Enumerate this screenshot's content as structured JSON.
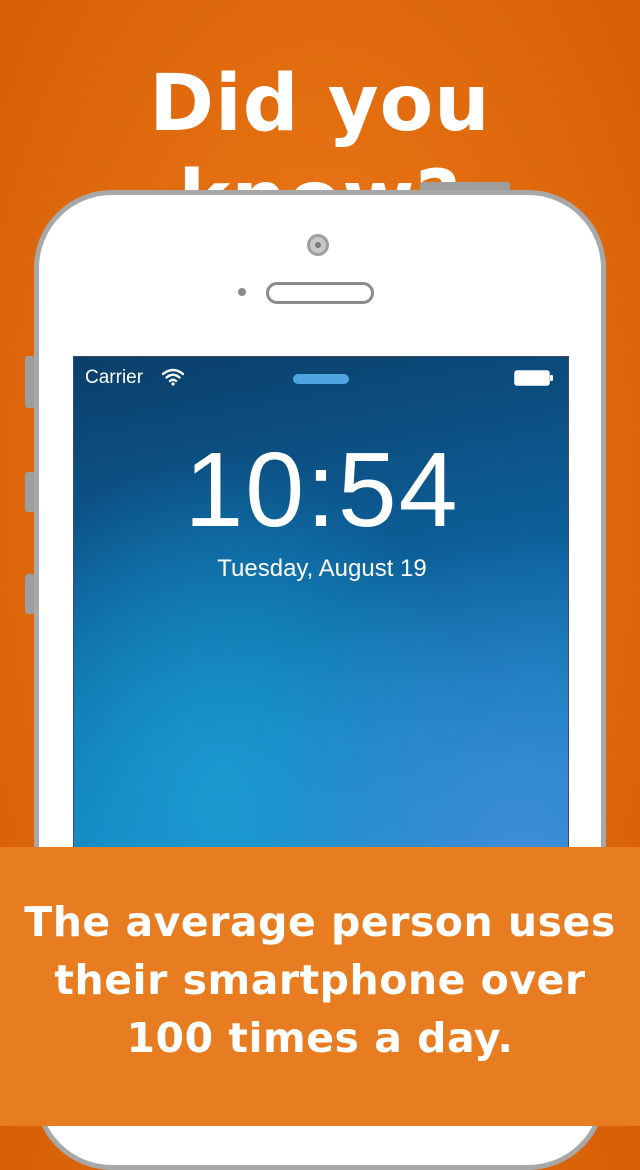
{
  "headline": "Did you know?",
  "lock_screen": {
    "carrier": "Carrier",
    "time": "10:54",
    "date": "Tuesday, August 19"
  },
  "caption": {
    "line1": "The average person uses",
    "line2": "their smartphone over",
    "line3": "100 times a day."
  },
  "colors": {
    "background": "#e06a0d",
    "panel": "#e87c21",
    "phone_body": "#ffffff",
    "screen_top": "#0b3f6a",
    "screen_bottom": "#1b8fcb"
  },
  "icons": [
    "wifi-icon",
    "battery-icon",
    "camera-icon",
    "speaker-icon"
  ]
}
